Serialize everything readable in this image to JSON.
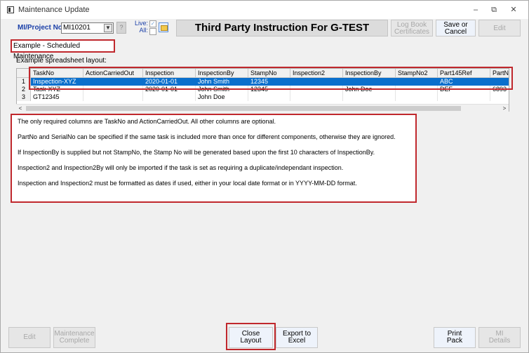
{
  "window": {
    "title": "Maintenance Update",
    "minimize": "–",
    "restore": "⧉",
    "close": "✕"
  },
  "toolbar": {
    "project_label": "MI/Project No:",
    "project_value": "MI10201",
    "question_label": "?",
    "live_label": "Live:",
    "all_label": "All:",
    "heading": "Third Party Instruction For G-TEST",
    "logbook_line1": "Log Book",
    "logbook_line2": "Certificates",
    "save_line1": "Save or",
    "save_line2": "Cancel",
    "edit_label": "Edit"
  },
  "example_label": "Example - Scheduled Maintenance",
  "layout_label": "Example spreadsheet layout:",
  "grid": {
    "columns": [
      "TaskNo",
      "ActionCarriedOut",
      "Inspection",
      "InspectionBy",
      "StampNo",
      "Inspection2",
      "InspectionBy",
      "StampNo2",
      "Part145Ref",
      "PartN"
    ],
    "rows": [
      {
        "num": "1",
        "cells": [
          "Inspection-XYZ",
          "",
          "2020-01-01",
          "John Smith",
          "12345",
          "",
          "",
          "",
          "ABC",
          ""
        ]
      },
      {
        "num": "2",
        "cells": [
          "Task-XYZ",
          "",
          "2020-01-01",
          "John Smith",
          "12345",
          "",
          "John Doe",
          "",
          "DEF",
          "6893"
        ]
      },
      {
        "num": "3",
        "cells": [
          "GT12345",
          "",
          "",
          "John Doe",
          "",
          "",
          "",
          "",
          "",
          ""
        ]
      }
    ],
    "scroll_left": "<",
    "scroll_right": ">"
  },
  "notes": [
    "The only required columns are TaskNo and ActionCarriedOut. All other columns are optional.",
    "PartNo and SerialNo can be specified if the same task is included more than once for different components, otherwise they are ignored.",
    "If InspectionBy is supplied but not StampNo, the Stamp No will be generated based upon the first 10 characters of InspectionBy.",
    "Inspection2 and Inspection2By will only be imported if the task is set as requiring a duplicate/independant inspection.",
    "Inspection and Inspection2 must be formatted as dates if used, either in your local date format or in YYYY-MM-DD format."
  ],
  "bottom": {
    "edit": "Edit",
    "maint_line1": "Maintenance",
    "maint_line2": "Complete",
    "close_line1": "Close",
    "close_line2": "Layout",
    "export_line1": "Export to",
    "export_line2": "Excel",
    "print_line1": "Print",
    "print_line2": "Pack",
    "mi_line1": "MI",
    "mi_line2": "Details"
  },
  "colors": {
    "highlight": "#c0282d",
    "selection": "#0a6fcc",
    "project_label": "#1a3fa8"
  }
}
